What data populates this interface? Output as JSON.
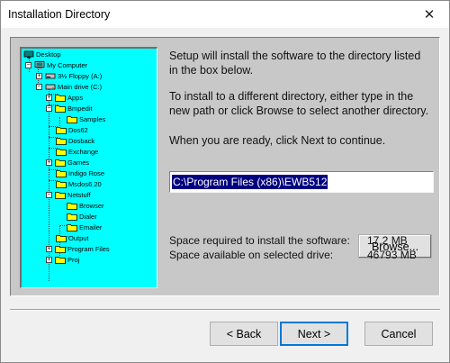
{
  "window": {
    "title": "Installation Directory",
    "close_glyph": "✕"
  },
  "tree": {
    "items": [
      {
        "label": "Desktop",
        "icon": "desktop-icon"
      },
      {
        "label": "My Computer",
        "icon": "computer-icon"
      },
      {
        "label": "3½ Floppy (A:)",
        "icon": "floppy-icon"
      },
      {
        "label": "Main drive (C:)",
        "icon": "drive-icon"
      },
      {
        "label": "Apps",
        "icon": "folder-icon"
      },
      {
        "label": "Bmpedit",
        "icon": "folder-icon"
      },
      {
        "label": "Samples",
        "icon": "folder-icon"
      },
      {
        "label": "Dos62",
        "icon": "folder-icon"
      },
      {
        "label": "Dosback",
        "icon": "folder-icon"
      },
      {
        "label": "Exchange",
        "icon": "folder-icon"
      },
      {
        "label": "Games",
        "icon": "folder-icon"
      },
      {
        "label": "Indigo Rose",
        "icon": "folder-icon"
      },
      {
        "label": "Msdos6.20",
        "icon": "folder-icon"
      },
      {
        "label": "Netstuff",
        "icon": "folder-icon"
      },
      {
        "label": "Browser",
        "icon": "folder-icon"
      },
      {
        "label": "Dialer",
        "icon": "folder-icon"
      },
      {
        "label": "Emailer",
        "icon": "folder-icon"
      },
      {
        "label": "Output",
        "icon": "folder-icon"
      },
      {
        "label": "Program Files",
        "icon": "folder-icon"
      },
      {
        "label": "Proj",
        "icon": "folder-icon"
      }
    ]
  },
  "text": {
    "para1": "Setup will install the software to the directory listed in the box below.",
    "para2": "To install to a different directory, either type in the new path or click Browse to select another directory.",
    "para3": "When you are ready, click Next to continue."
  },
  "path": {
    "value": "C:\\Program Files (x86)\\EWB512"
  },
  "buttons": {
    "browse": "Browse...",
    "back": "< Back",
    "next": "Next >",
    "cancel": "Cancel"
  },
  "space": {
    "required_label": "Space required to install the software:",
    "required_value": "17.2 MB",
    "available_label": "Space available on selected drive:",
    "available_value": "46793 MB"
  },
  "colors": {
    "tree_bg": "#00ffff",
    "folder": "#ffff00",
    "selection": "#000080",
    "default_button_border": "#0078d7"
  }
}
